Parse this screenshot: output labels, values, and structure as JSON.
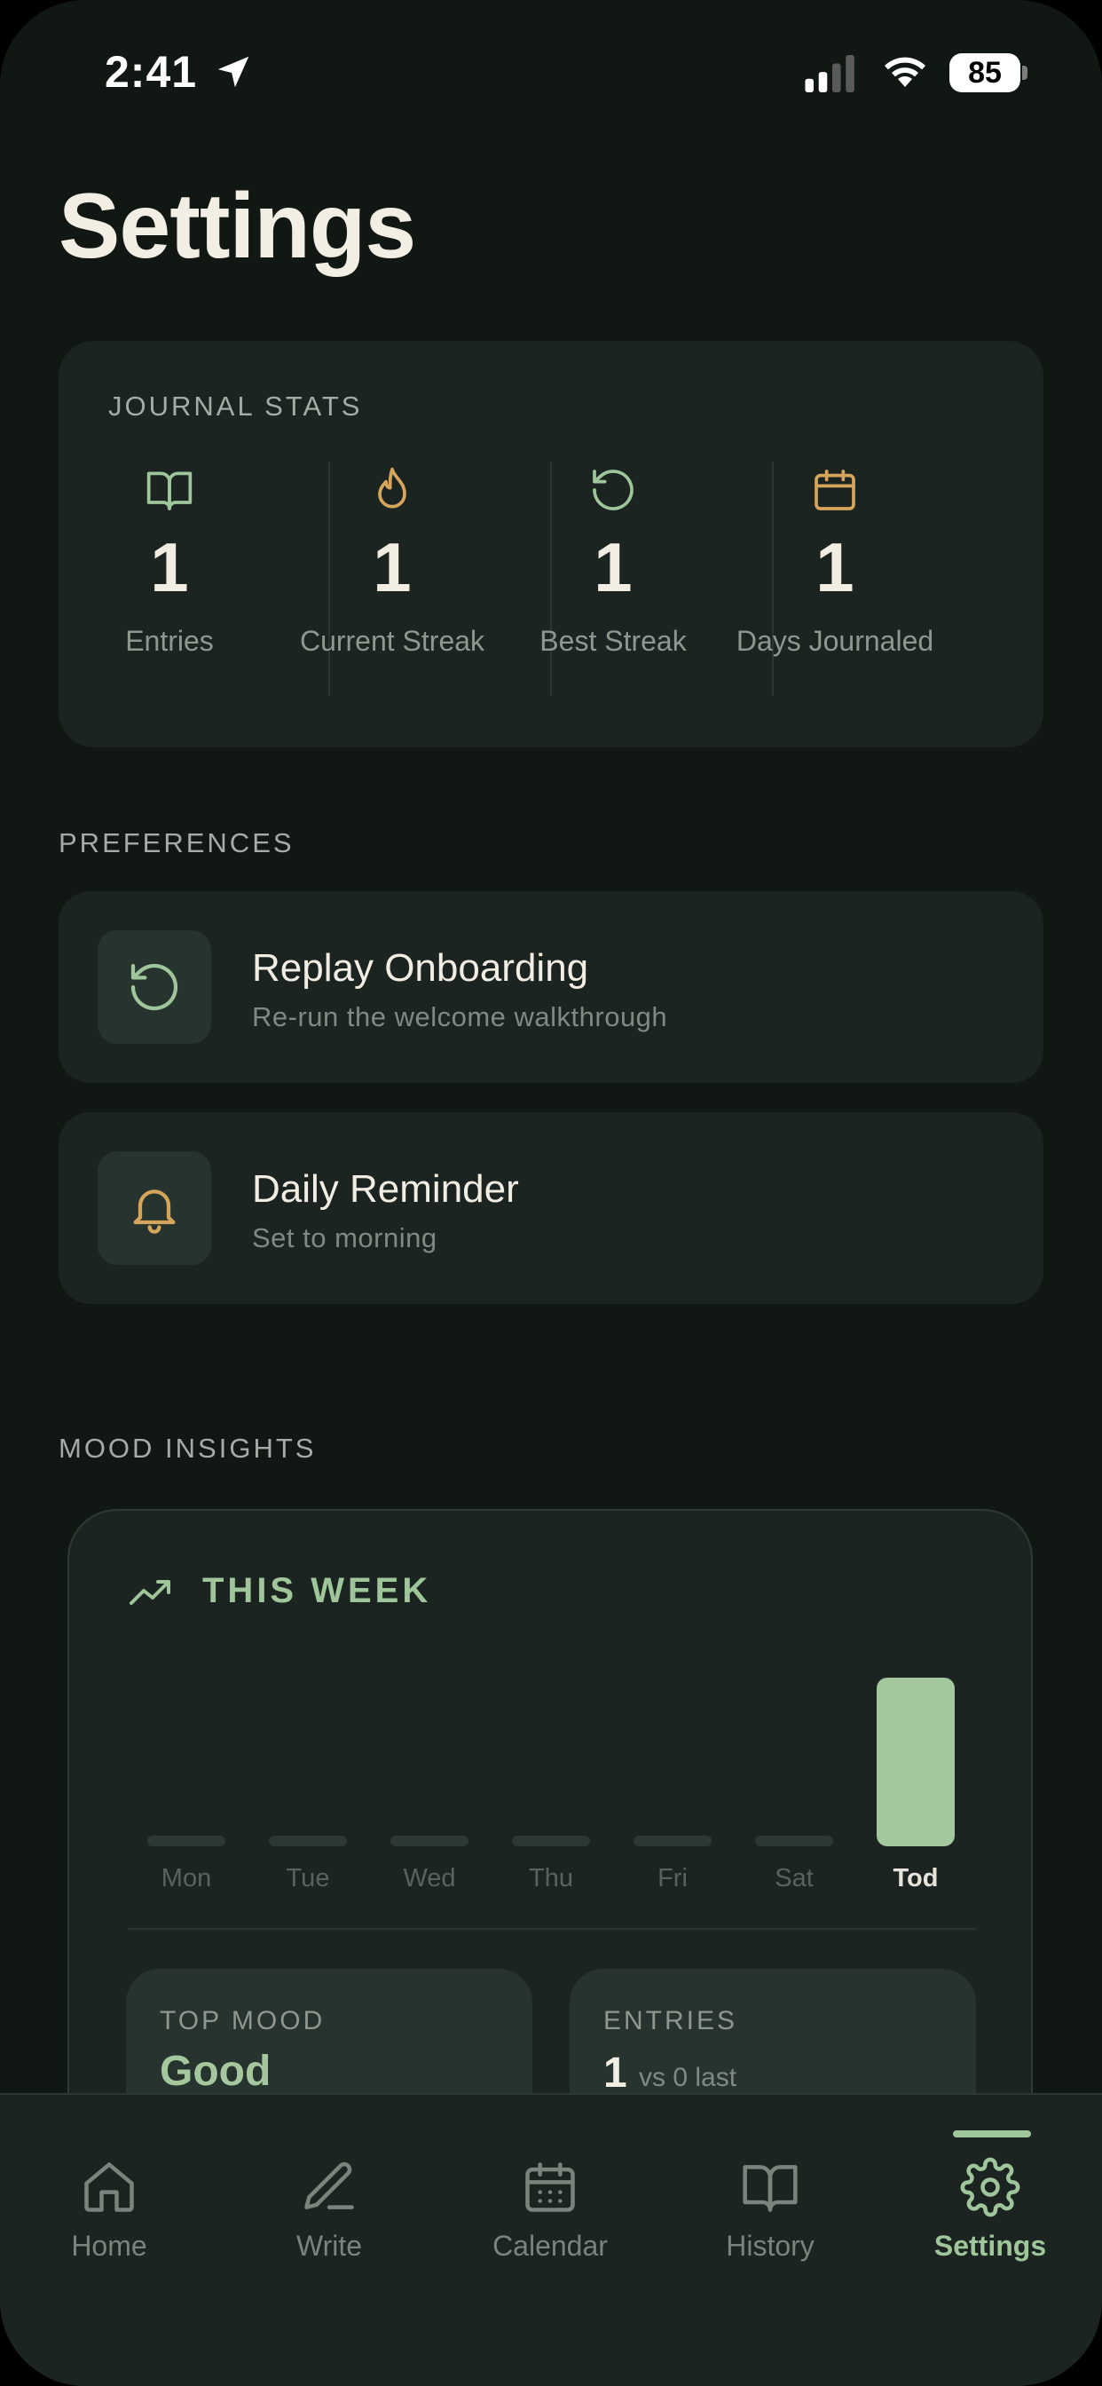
{
  "status_bar": {
    "time": "2:41",
    "battery": "85"
  },
  "page": {
    "title": "Settings"
  },
  "journal_stats": {
    "label": "JOURNAL STATS",
    "items": [
      {
        "icon": "book-icon",
        "value": "1",
        "label": "Entries"
      },
      {
        "icon": "flame-icon",
        "value": "1",
        "label": "Current Streak"
      },
      {
        "icon": "rotate-icon",
        "value": "1",
        "label": "Best Streak"
      },
      {
        "icon": "calendar-icon",
        "value": "1",
        "label": "Days Journaled"
      }
    ]
  },
  "preferences": {
    "label": "PREFERENCES",
    "items": [
      {
        "icon": "rotate-icon",
        "title": "Replay Onboarding",
        "subtitle": "Re-run the welcome walkthrough"
      },
      {
        "icon": "bell-icon",
        "title": "Daily Reminder",
        "subtitle": "Set to morning"
      }
    ]
  },
  "mood_insights": {
    "label": "MOOD INSIGHTS",
    "card_title": "THIS WEEK",
    "top_mood": {
      "label": "TOP MOOD",
      "value": "Good"
    },
    "entries": {
      "label": "ENTRIES",
      "value": "1",
      "comparison": "vs 0 last"
    }
  },
  "chart_data": {
    "type": "bar",
    "categories": [
      "Mon",
      "Tue",
      "Wed",
      "Thu",
      "Fri",
      "Sat",
      "Tod"
    ],
    "values": [
      0,
      0,
      0,
      0,
      0,
      0,
      1
    ],
    "highlight": "Tod"
  },
  "tabbar": {
    "items": [
      {
        "icon": "home-icon",
        "label": "Home"
      },
      {
        "icon": "pencil-icon",
        "label": "Write"
      },
      {
        "icon": "calendar-icon",
        "label": "Calendar"
      },
      {
        "icon": "book-icon",
        "label": "History"
      },
      {
        "icon": "gear-icon",
        "label": "Settings"
      }
    ],
    "active": "Settings"
  },
  "colors": {
    "accent": "#9fc59b",
    "gold": "#d6a55c",
    "background": "#111713",
    "card": "#1b2421"
  }
}
